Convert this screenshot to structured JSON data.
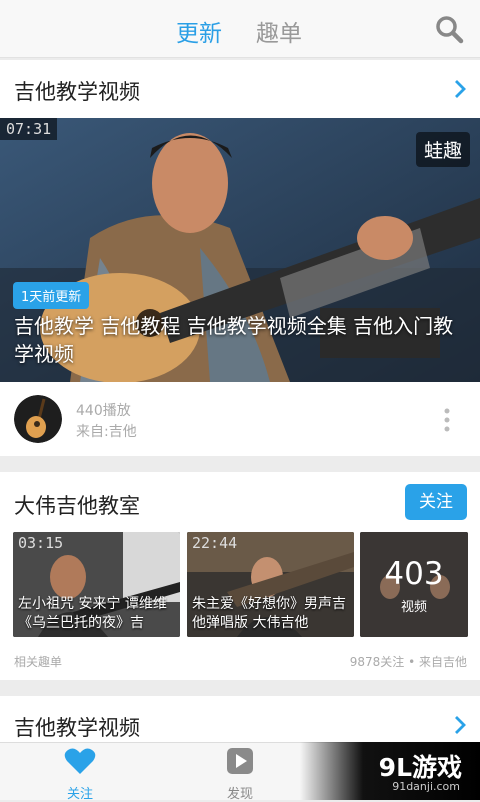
{
  "header": {
    "tab_active": "更新",
    "tab_inactive": "趣单"
  },
  "section1": {
    "title": "吉他教学视频"
  },
  "featured": {
    "duration": "07:31",
    "watermark": "蛙趣",
    "badge": "1天前更新",
    "title": "吉他教学 吉他教程 吉他教学视频全集 吉他入门教学视频",
    "plays": "440播放",
    "from": "来自:吉他"
  },
  "channel": {
    "title": "大伟吉他教室",
    "follow_label": "关注",
    "thumbs": [
      {
        "duration": "03:15",
        "caption": "左小祖咒 安来宁 谭维维《乌兰巴托的夜》吉"
      },
      {
        "duration": "22:44",
        "caption": "朱主爱《好想你》男声吉他弹唱版 大伟吉他"
      }
    ],
    "count": "403",
    "count_label": "视频",
    "related": "相关趣单",
    "followers": "9878关注 • 来自吉他"
  },
  "section2": {
    "title": "吉他教学视频"
  },
  "bottom_nav": {
    "follow": "关注",
    "discover": "发现"
  },
  "brand": {
    "logo": "9L游戏",
    "url": "91danji.com"
  },
  "colors": {
    "accent": "#2aa2e8"
  }
}
